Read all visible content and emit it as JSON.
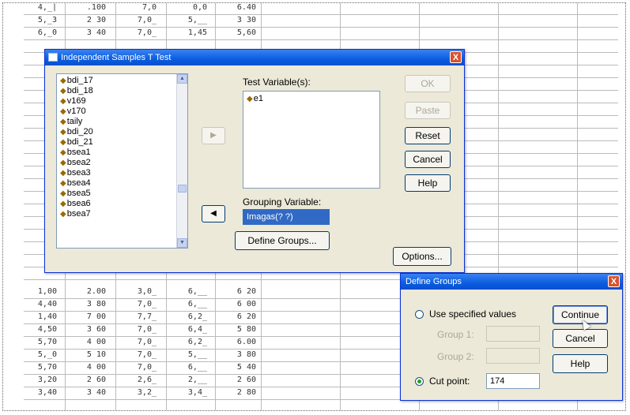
{
  "spreadsheet": {
    "rows_top": [
      [
        "4,_|",
        ".100",
        "7,0",
        "0,0",
        "6.40"
      ],
      [
        "5,_3",
        "2 30",
        "7,0_",
        "5,__",
        "3 30"
      ],
      [
        "6,_0",
        "3 40",
        "7,0_",
        "1,45",
        "5,60"
      ]
    ],
    "rows_bottom": [
      [
        "1,00",
        "2.00",
        "3,0_",
        "6,__",
        "6 20"
      ],
      [
        "4,40",
        "3 80",
        "7,0_",
        "6,__",
        "6 00"
      ],
      [
        "1,40",
        "7 00",
        "7,7_",
        "6,2_",
        "6 20"
      ],
      [
        "4,50",
        "3 60",
        "7,0_",
        "6,4_",
        "5 80"
      ],
      [
        "5,70",
        "4 00",
        "7,0_",
        "6,2_",
        "6.00"
      ],
      [
        "5,_0",
        "5 10",
        "7,0_",
        "5,__",
        "3 80"
      ],
      [
        "5,70",
        "4 00",
        "7,0_",
        "6,__",
        "5 40"
      ],
      [
        "3,20",
        "2 60",
        "2,6_",
        "2,__",
        "2 60"
      ],
      [
        "3,40",
        "3 40",
        "3,2_",
        "3,4_",
        "2 80"
      ]
    ]
  },
  "ttest_dialog": {
    "title": "Independent Samples T Test",
    "close_label": "X",
    "variables": [
      "bdi_17",
      "bdi_18",
      "v169",
      "v170",
      "taily",
      "bdi_20",
      "bdi_21",
      "bsea1",
      "bsea2",
      "bsea3",
      "bsea4",
      "bsea5",
      "bsea6",
      "bsea7"
    ],
    "test_variables_label": "Test Variable(s):",
    "test_variables": [
      "e1"
    ],
    "move_arrow": "▶",
    "move_arrow_group": "◀",
    "grouping_variable_label": "Grouping Variable:",
    "grouping_variable_value": "Imagas(? ?)",
    "define_groups_label": "Define Groups...",
    "buttons": {
      "ok": "OK",
      "paste": "Paste",
      "reset": "Reset",
      "cancel": "Cancel",
      "help": "Help",
      "options": "Options..."
    }
  },
  "define_groups_dialog": {
    "title": "Define Groups",
    "close_label": "X",
    "use_specified_label": "Use specified values",
    "group1_label": "Group 1:",
    "group2_label": "Group 2:",
    "cut_point_label": "Cut point:",
    "cut_point_value": "174",
    "continue_label": "Continue",
    "cancel_label": "Cancel",
    "help_label": "Help"
  }
}
